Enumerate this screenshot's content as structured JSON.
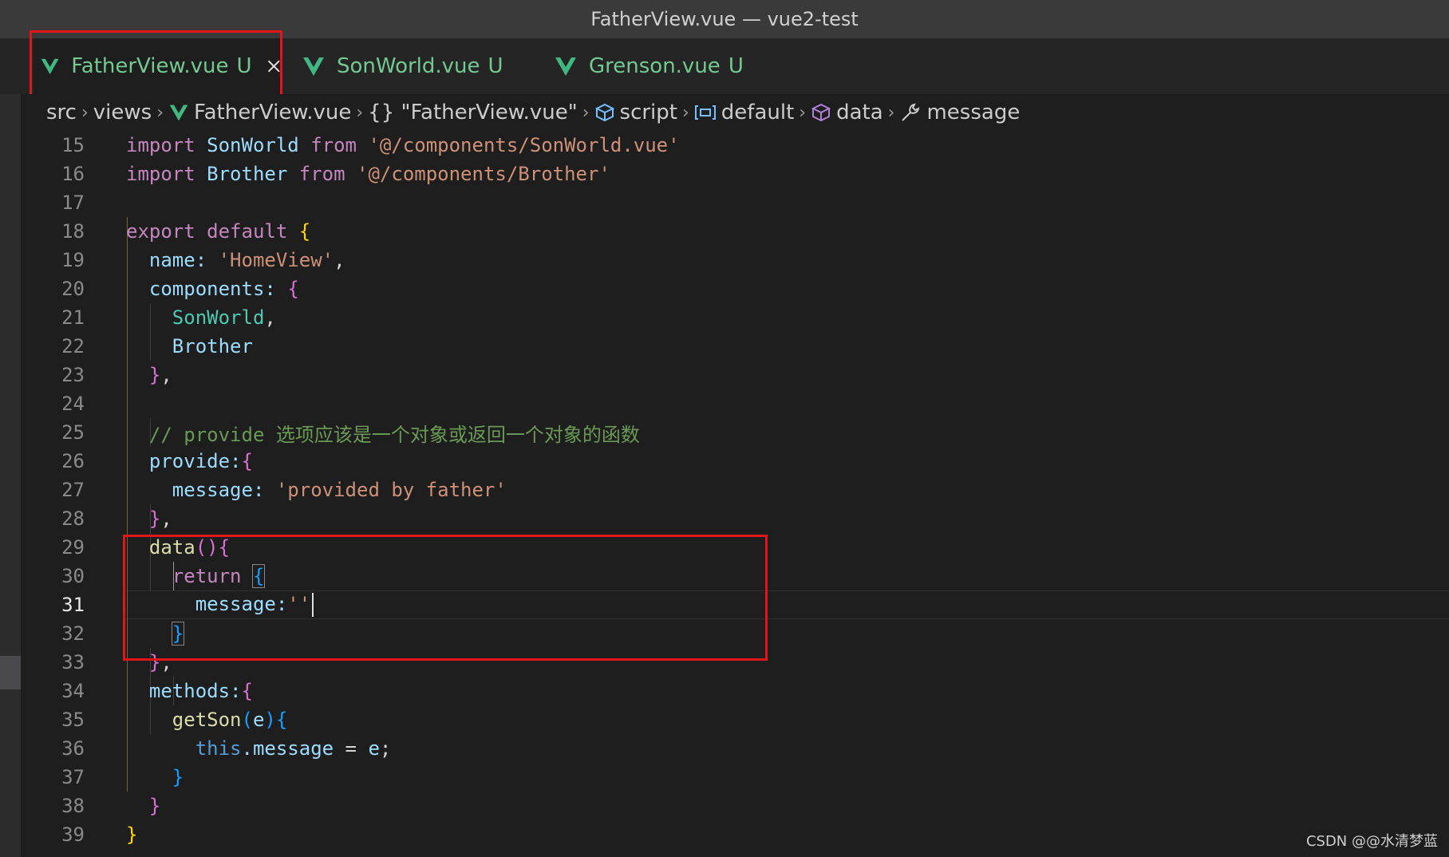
{
  "window": {
    "title": "FatherView.vue — vue2-test"
  },
  "tabs": [
    {
      "name": "FatherView.vue",
      "status": "U",
      "active": true
    },
    {
      "name": "SonWorld.vue",
      "status": "U",
      "active": false
    },
    {
      "name": "Grenson.vue",
      "status": "U",
      "active": false
    }
  ],
  "breadcrumb": [
    "src",
    "views",
    "FatherView.vue",
    "{} \"FatherView.vue\"",
    "script",
    "default",
    "data",
    "message"
  ],
  "editor": {
    "current_line": 31,
    "lines": [
      {
        "n": "15"
      },
      {
        "n": "16"
      },
      {
        "n": "17"
      },
      {
        "n": "18"
      },
      {
        "n": "19"
      },
      {
        "n": "20"
      },
      {
        "n": "21"
      },
      {
        "n": "22"
      },
      {
        "n": "23"
      },
      {
        "n": "24"
      },
      {
        "n": "25"
      },
      {
        "n": "26"
      },
      {
        "n": "27"
      },
      {
        "n": "28"
      },
      {
        "n": "29"
      },
      {
        "n": "30"
      },
      {
        "n": "31"
      },
      {
        "n": "32"
      },
      {
        "n": "33"
      },
      {
        "n": "34"
      },
      {
        "n": "35"
      },
      {
        "n": "36"
      },
      {
        "n": "37"
      },
      {
        "n": "38"
      },
      {
        "n": "39"
      }
    ],
    "tokens": {
      "l15": [
        "import",
        "SonWorld",
        "from",
        "'@/components/SonWorld.vue'"
      ],
      "l16": [
        "import",
        "Brother",
        "from",
        "'@/components/Brother'"
      ],
      "l18": [
        "export",
        "default",
        "{"
      ],
      "l19": [
        "name:",
        "'HomeView'",
        ","
      ],
      "l20": [
        "components:",
        "{"
      ],
      "l21": [
        "SonWorld",
        ","
      ],
      "l22": [
        "Brother"
      ],
      "l23": [
        "}",
        ","
      ],
      "l25": [
        "// provide 选项应该是一个对象或返回一个对象的函数"
      ],
      "l26": [
        "provide:",
        "{"
      ],
      "l27": [
        "message:",
        "'provided by father'"
      ],
      "l28": [
        "}",
        ","
      ],
      "l29": [
        "data",
        "()",
        "{"
      ],
      "l30": [
        "return",
        "{"
      ],
      "l31": [
        "message:",
        "''"
      ],
      "l32": [
        "}"
      ],
      "l33": [
        "}",
        ","
      ],
      "l34": [
        "methods:",
        "{"
      ],
      "l35": [
        "getSon",
        "(",
        "e",
        ")",
        "{"
      ],
      "l36": [
        "this",
        ".message",
        " = ",
        "e",
        ";"
      ],
      "l37": [
        "}"
      ],
      "l38": [
        "}"
      ],
      "l39": [
        "}"
      ]
    }
  },
  "watermark": "CSDN @@水清梦蓝",
  "colors": {
    "accent_red": "#e0161b",
    "vue_green": "#41b883",
    "untracked": "#73c991"
  }
}
